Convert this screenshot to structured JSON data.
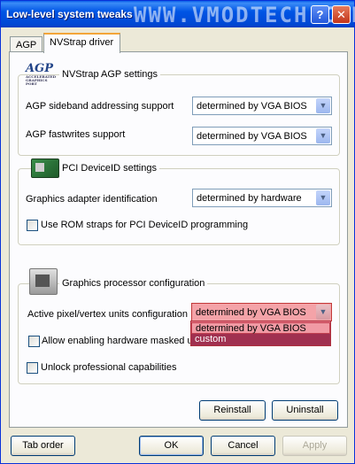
{
  "window": {
    "title": "Low-level system tweaks",
    "watermark": "WWW.VMODTECH.COM",
    "help_glyph": "?",
    "close_glyph": "✕"
  },
  "tabs": [
    {
      "label": "AGP",
      "active": false
    },
    {
      "label": "NVStrap driver",
      "active": true
    }
  ],
  "agp_group": {
    "title": "NVStrap AGP settings",
    "icon": "agp-logo-icon",
    "icon_text": "AGP",
    "icon_subtext": "ACCELERATED GRAPHICS PORT",
    "sideband_label": "AGP sideband addressing support",
    "sideband_value": "determined by VGA BIOS",
    "fastwrites_label": "AGP fastwrites support",
    "fastwrites_value": "determined by VGA BIOS"
  },
  "pci_group": {
    "title": "PCI DeviceID settings",
    "icon": "pci-card-icon",
    "adapter_label": "Graphics adapter identification",
    "adapter_value": "determined by hardware",
    "rom_straps_label": "Use ROM straps for PCI DeviceID programming",
    "rom_straps_checked": false
  },
  "gpu_group": {
    "title": "Graphics processor configuration",
    "icon": "gpu-chip-icon",
    "units_label": "Active pixel/vertex units configuration",
    "units_value": "determined by VGA BIOS",
    "units_options": [
      "determined by VGA BIOS",
      "custom"
    ],
    "masked_label": "Allow enabling hardware masked un",
    "masked_checked": false,
    "unlock_label": "Unlock professional capabilities",
    "unlock_checked": false
  },
  "panel_buttons": {
    "reinstall": "Reinstall",
    "uninstall": "Uninstall"
  },
  "footer": {
    "tab_order": "Tab order",
    "ok": "OK",
    "cancel": "Cancel",
    "apply": "Apply"
  },
  "colors": {
    "titlebar": "#0055e5",
    "highlight_combo": "#f4a3a8",
    "dropdown_selected": "#a03050"
  }
}
